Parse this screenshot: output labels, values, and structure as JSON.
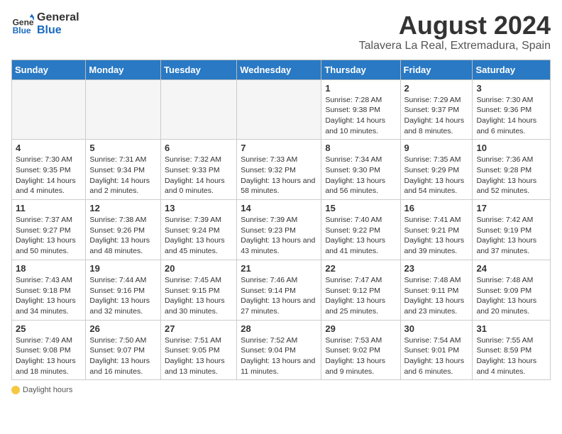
{
  "logo": {
    "line1": "General",
    "line2": "Blue"
  },
  "title": "August 2024",
  "subtitle": "Talavera La Real, Extremadura, Spain",
  "weekdays": [
    "Sunday",
    "Monday",
    "Tuesday",
    "Wednesday",
    "Thursday",
    "Friday",
    "Saturday"
  ],
  "weeks": [
    [
      {
        "day": "",
        "info": ""
      },
      {
        "day": "",
        "info": ""
      },
      {
        "day": "",
        "info": ""
      },
      {
        "day": "",
        "info": ""
      },
      {
        "day": "1",
        "info": "Sunrise: 7:28 AM\nSunset: 9:38 PM\nDaylight: 14 hours and 10 minutes."
      },
      {
        "day": "2",
        "info": "Sunrise: 7:29 AM\nSunset: 9:37 PM\nDaylight: 14 hours and 8 minutes."
      },
      {
        "day": "3",
        "info": "Sunrise: 7:30 AM\nSunset: 9:36 PM\nDaylight: 14 hours and 6 minutes."
      }
    ],
    [
      {
        "day": "4",
        "info": "Sunrise: 7:30 AM\nSunset: 9:35 PM\nDaylight: 14 hours and 4 minutes."
      },
      {
        "day": "5",
        "info": "Sunrise: 7:31 AM\nSunset: 9:34 PM\nDaylight: 14 hours and 2 minutes."
      },
      {
        "day": "6",
        "info": "Sunrise: 7:32 AM\nSunset: 9:33 PM\nDaylight: 14 hours and 0 minutes."
      },
      {
        "day": "7",
        "info": "Sunrise: 7:33 AM\nSunset: 9:32 PM\nDaylight: 13 hours and 58 minutes."
      },
      {
        "day": "8",
        "info": "Sunrise: 7:34 AM\nSunset: 9:30 PM\nDaylight: 13 hours and 56 minutes."
      },
      {
        "day": "9",
        "info": "Sunrise: 7:35 AM\nSunset: 9:29 PM\nDaylight: 13 hours and 54 minutes."
      },
      {
        "day": "10",
        "info": "Sunrise: 7:36 AM\nSunset: 9:28 PM\nDaylight: 13 hours and 52 minutes."
      }
    ],
    [
      {
        "day": "11",
        "info": "Sunrise: 7:37 AM\nSunset: 9:27 PM\nDaylight: 13 hours and 50 minutes."
      },
      {
        "day": "12",
        "info": "Sunrise: 7:38 AM\nSunset: 9:26 PM\nDaylight: 13 hours and 48 minutes."
      },
      {
        "day": "13",
        "info": "Sunrise: 7:39 AM\nSunset: 9:24 PM\nDaylight: 13 hours and 45 minutes."
      },
      {
        "day": "14",
        "info": "Sunrise: 7:39 AM\nSunset: 9:23 PM\nDaylight: 13 hours and 43 minutes."
      },
      {
        "day": "15",
        "info": "Sunrise: 7:40 AM\nSunset: 9:22 PM\nDaylight: 13 hours and 41 minutes."
      },
      {
        "day": "16",
        "info": "Sunrise: 7:41 AM\nSunset: 9:21 PM\nDaylight: 13 hours and 39 minutes."
      },
      {
        "day": "17",
        "info": "Sunrise: 7:42 AM\nSunset: 9:19 PM\nDaylight: 13 hours and 37 minutes."
      }
    ],
    [
      {
        "day": "18",
        "info": "Sunrise: 7:43 AM\nSunset: 9:18 PM\nDaylight: 13 hours and 34 minutes."
      },
      {
        "day": "19",
        "info": "Sunrise: 7:44 AM\nSunset: 9:16 PM\nDaylight: 13 hours and 32 minutes."
      },
      {
        "day": "20",
        "info": "Sunrise: 7:45 AM\nSunset: 9:15 PM\nDaylight: 13 hours and 30 minutes."
      },
      {
        "day": "21",
        "info": "Sunrise: 7:46 AM\nSunset: 9:14 PM\nDaylight: 13 hours and 27 minutes."
      },
      {
        "day": "22",
        "info": "Sunrise: 7:47 AM\nSunset: 9:12 PM\nDaylight: 13 hours and 25 minutes."
      },
      {
        "day": "23",
        "info": "Sunrise: 7:48 AM\nSunset: 9:11 PM\nDaylight: 13 hours and 23 minutes."
      },
      {
        "day": "24",
        "info": "Sunrise: 7:48 AM\nSunset: 9:09 PM\nDaylight: 13 hours and 20 minutes."
      }
    ],
    [
      {
        "day": "25",
        "info": "Sunrise: 7:49 AM\nSunset: 9:08 PM\nDaylight: 13 hours and 18 minutes."
      },
      {
        "day": "26",
        "info": "Sunrise: 7:50 AM\nSunset: 9:07 PM\nDaylight: 13 hours and 16 minutes."
      },
      {
        "day": "27",
        "info": "Sunrise: 7:51 AM\nSunset: 9:05 PM\nDaylight: 13 hours and 13 minutes."
      },
      {
        "day": "28",
        "info": "Sunrise: 7:52 AM\nSunset: 9:04 PM\nDaylight: 13 hours and 11 minutes."
      },
      {
        "day": "29",
        "info": "Sunrise: 7:53 AM\nSunset: 9:02 PM\nDaylight: 13 hours and 9 minutes."
      },
      {
        "day": "30",
        "info": "Sunrise: 7:54 AM\nSunset: 9:01 PM\nDaylight: 13 hours and 6 minutes."
      },
      {
        "day": "31",
        "info": "Sunrise: 7:55 AM\nSunset: 8:59 PM\nDaylight: 13 hours and 4 minutes."
      }
    ]
  ],
  "footer": {
    "icon": "sun",
    "label": "Daylight hours"
  }
}
